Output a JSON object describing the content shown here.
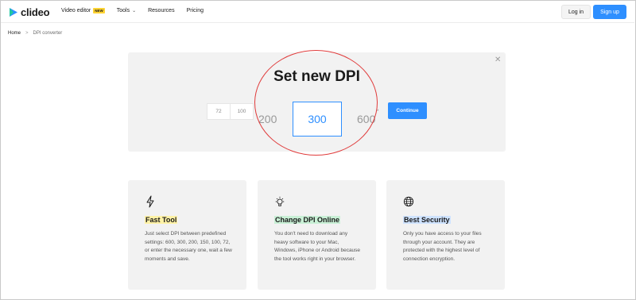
{
  "header": {
    "logo_text": "clideo",
    "nav": [
      {
        "label": "Video editor",
        "badge": "NEW"
      },
      {
        "label": "Tools",
        "dropdown": true
      },
      {
        "label": "Resources"
      },
      {
        "label": "Pricing"
      }
    ],
    "login_label": "Log in",
    "signup_label": "Sign up"
  },
  "breadcrumb": {
    "home": "Home",
    "separator": ">",
    "current": "DPI converter"
  },
  "panel": {
    "title": "Set new DPI",
    "close_icon": "close-icon",
    "small_options": [
      "72",
      "100"
    ],
    "large_options": {
      "left": "200",
      "selected": "300",
      "right": "600"
    },
    "trailing_mark": "*",
    "continue_label": "Continue"
  },
  "features": [
    {
      "icon": "lightning-icon",
      "title": "Fast Tool",
      "desc": "Just select DPI between predefined settings: 600, 300, 200, 150, 100, 72, or enter the necessary one, wait a few moments and save."
    },
    {
      "icon": "lightbulb-icon",
      "title": "Change DPI Online",
      "desc": "You don't need to download any heavy software to your Mac, Windows, iPhone or Android because the tool works right in your browser."
    },
    {
      "icon": "globe-icon",
      "title": "Best Security",
      "desc": "Only you have access to your files through your account. They are protected with the highest level of connection encryption."
    }
  ],
  "colors": {
    "accent": "#2e8fff",
    "annotation": "#e03b3b",
    "badge": "#ffd332"
  }
}
